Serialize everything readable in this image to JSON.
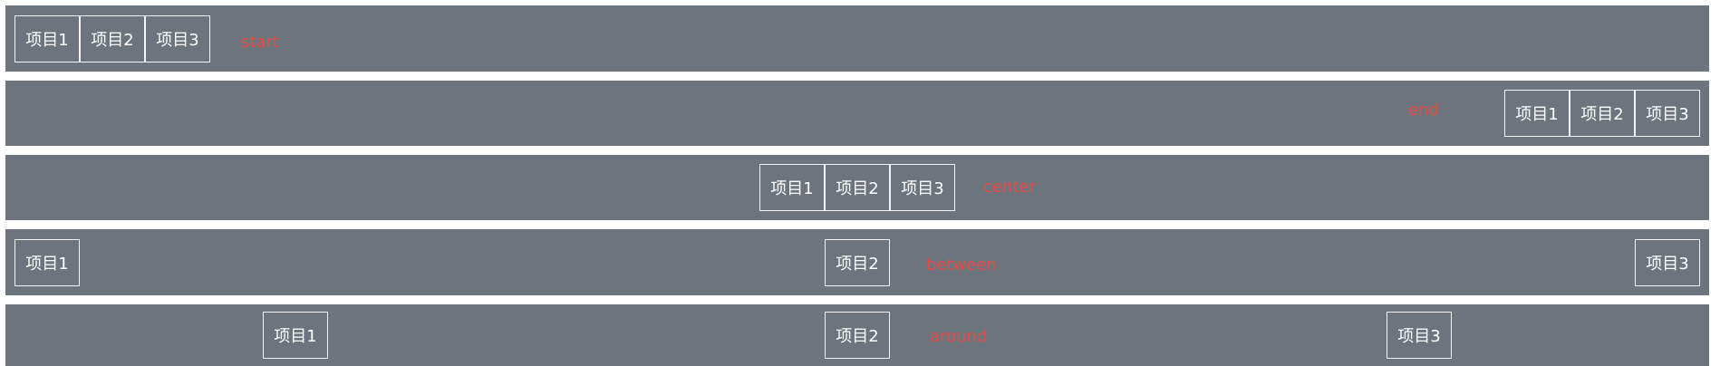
{
  "rows": [
    {
      "key": "start",
      "label": "start",
      "items": [
        "项目1",
        "项目2",
        "项目3"
      ]
    },
    {
      "key": "end",
      "label": "end",
      "items": [
        "项目1",
        "项目2",
        "项目3"
      ]
    },
    {
      "key": "center",
      "label": "center",
      "items": [
        "项目1",
        "项目2",
        "项目3"
      ]
    },
    {
      "key": "between",
      "label": "between",
      "items": [
        "项目1",
        "项目2",
        "项目3"
      ]
    },
    {
      "key": "around",
      "label": "around",
      "items": [
        "项目1",
        "项目2",
        "项目3"
      ]
    }
  ],
  "colors": {
    "row_background": "#6c757d",
    "item_text": "#ffffff",
    "item_border": "#f2f2f2",
    "label_text": "#e74a45"
  }
}
